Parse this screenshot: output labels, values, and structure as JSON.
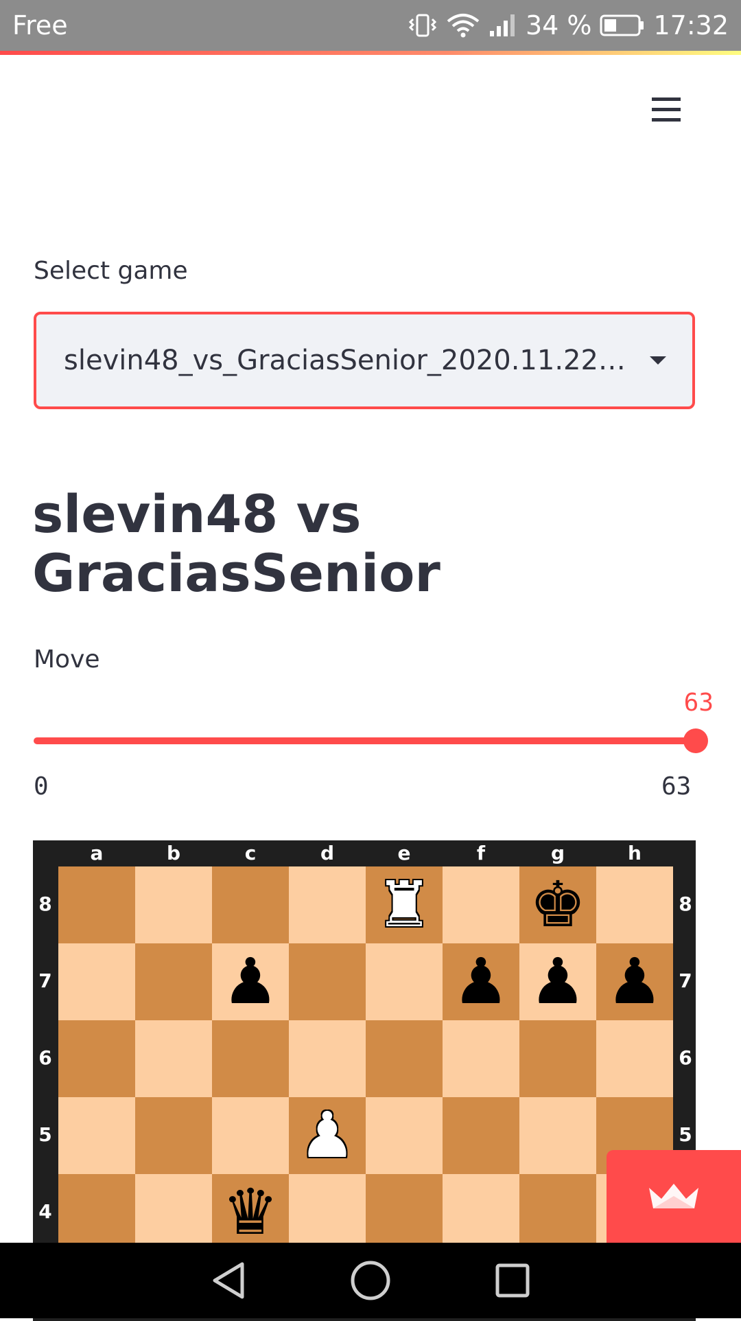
{
  "status_bar": {
    "carrier": "Free",
    "battery_percent": "34 %",
    "time": "17:32",
    "icons": [
      "vibrate-icon",
      "wifi-icon",
      "signal-icon",
      "battery-icon"
    ]
  },
  "header": {
    "menu_icon": "hamburger-menu-icon"
  },
  "select_game": {
    "label": "Select game",
    "value": "slevin48_vs_GraciasSenior_2020.11.22…"
  },
  "game": {
    "title": "slevin48 vs GraciasSenior"
  },
  "move_slider": {
    "label": "Move",
    "value": "63",
    "min": "0",
    "max": "63",
    "fraction": 1.0
  },
  "board": {
    "files": [
      "a",
      "b",
      "c",
      "d",
      "e",
      "f",
      "g",
      "h"
    ],
    "ranks": [
      "8",
      "7",
      "6",
      "5",
      "4"
    ],
    "pieces": [
      {
        "square": "e8",
        "piece": "rook",
        "color": "white",
        "glyph": "♜"
      },
      {
        "square": "g8",
        "piece": "king",
        "color": "black",
        "glyph": "♚"
      },
      {
        "square": "c7",
        "piece": "pawn",
        "color": "black",
        "glyph": "♟"
      },
      {
        "square": "f7",
        "piece": "pawn",
        "color": "black",
        "glyph": "♟"
      },
      {
        "square": "g7",
        "piece": "pawn",
        "color": "black",
        "glyph": "♟"
      },
      {
        "square": "h7",
        "piece": "pawn",
        "color": "black",
        "glyph": "♟"
      },
      {
        "square": "d5",
        "piece": "pawn",
        "color": "white",
        "glyph": "♟"
      },
      {
        "square": "c4",
        "piece": "queen",
        "color": "black",
        "glyph": "♛"
      }
    ],
    "colors": {
      "light": "#fdcea1",
      "dark": "#d18b47",
      "frame": "#1f1f1f"
    }
  },
  "fab": {
    "icon": "streamlit-crown-icon"
  },
  "nav_bar": {
    "icons": [
      "back-triangle-icon",
      "home-circle-icon",
      "recents-square-icon"
    ]
  },
  "colors": {
    "accent": "#ff4b4b",
    "text": "#31333f",
    "input_bg": "#f0f2f6"
  }
}
